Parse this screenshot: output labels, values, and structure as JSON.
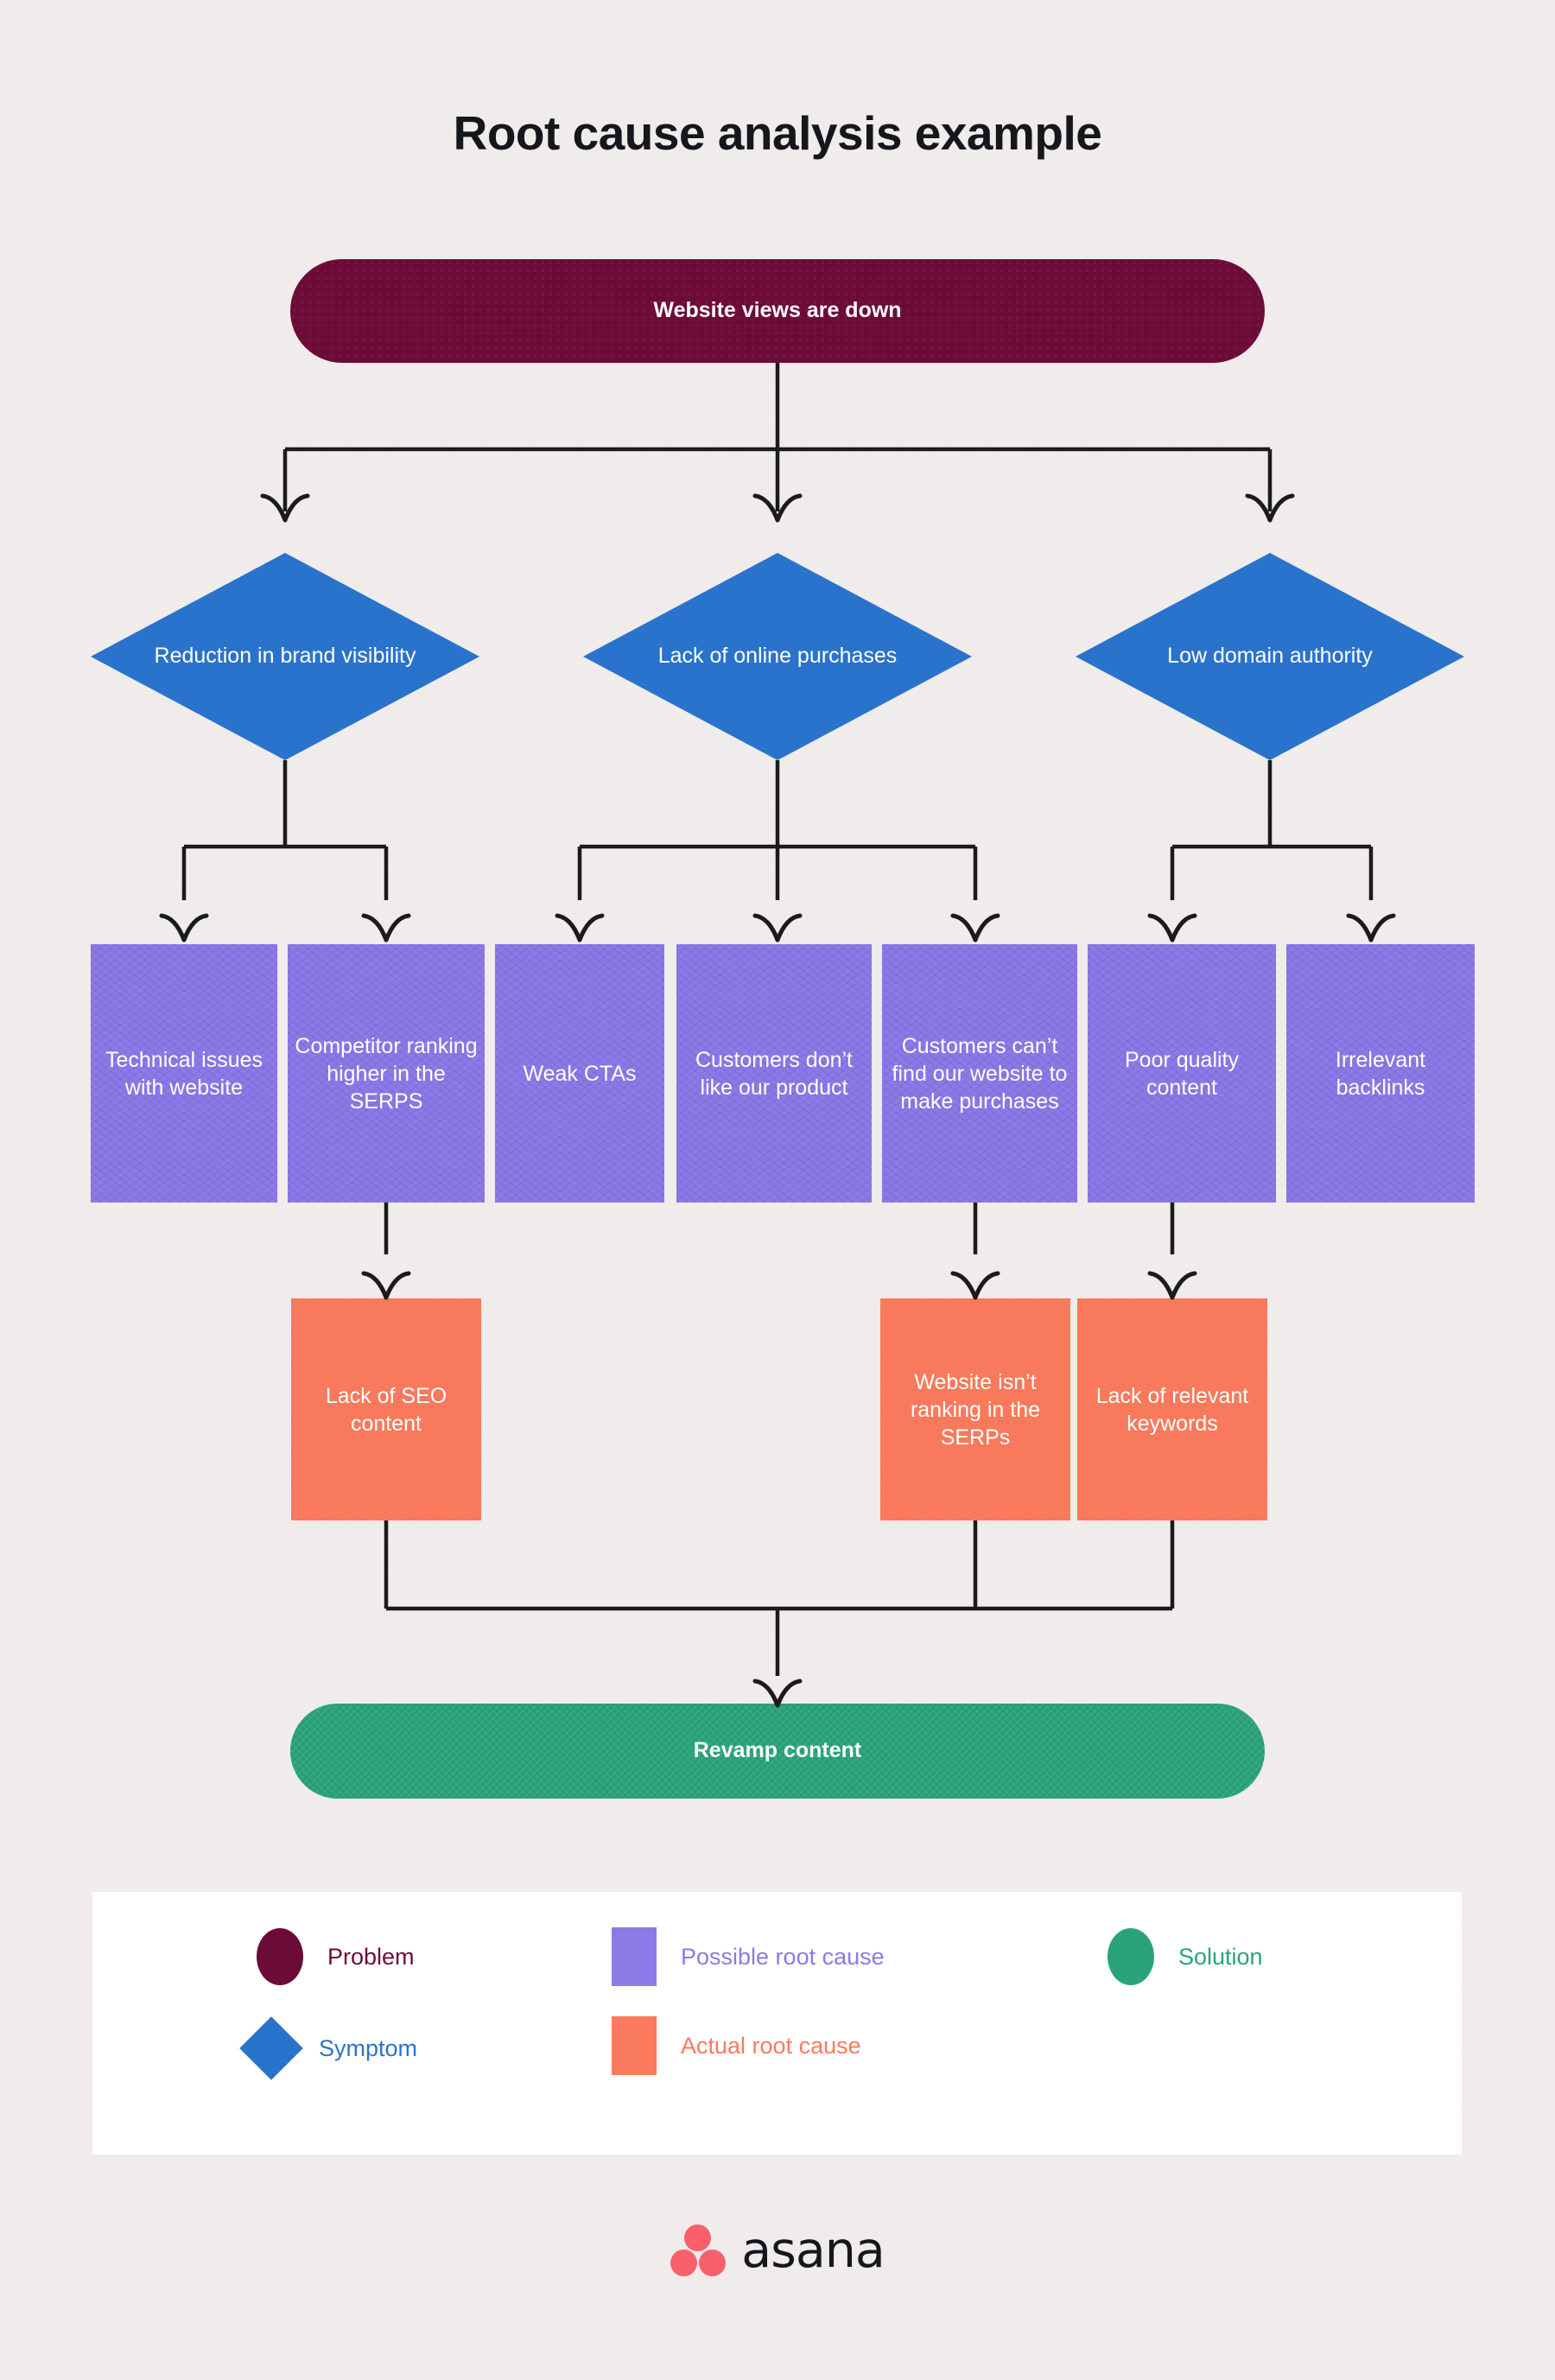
{
  "page": {
    "title": "Root cause analysis example"
  },
  "colors": {
    "background": "#efeceb",
    "problem": "#6d0b38",
    "symptom": "#2a73cc",
    "possible_root_cause": "#8c7ae6",
    "actual_root_cause": "#f97a5c",
    "solution": "#2aa37c",
    "connector": "#1b1b1b",
    "legend_panel": "#ffffff",
    "node_text": "#ffffff",
    "title_text": "#16161d",
    "logo_dot": "#f9606a"
  },
  "flow": {
    "problem": {
      "label": "Website views are down",
      "shape": "pill"
    },
    "symptoms": [
      {
        "label": "Reduction in brand visibility",
        "shape": "diamond"
      },
      {
        "label": "Lack of online purchases",
        "shape": "diamond"
      },
      {
        "label": "Low domain authority",
        "shape": "diamond"
      }
    ],
    "possible_root_causes": [
      {
        "label": "Technical issues with website",
        "shape": "rectangle"
      },
      {
        "label": "Competitor ranking higher in the SERPS",
        "shape": "rectangle"
      },
      {
        "label": "Weak CTAs",
        "shape": "rectangle"
      },
      {
        "label": "Customers don’t like our product",
        "shape": "rectangle"
      },
      {
        "label": "Customers can’t find our website to make purchases",
        "shape": "rectangle"
      },
      {
        "label": "Poor quality content",
        "shape": "rectangle"
      },
      {
        "label": "Irrelevant backlinks",
        "shape": "rectangle"
      }
    ],
    "actual_root_causes": [
      {
        "label": "Lack of SEO content",
        "shape": "rectangle"
      },
      {
        "label": "Website isn’t ranking in the SERPs",
        "shape": "rectangle"
      },
      {
        "label": "Lack of relevant keywords",
        "shape": "rectangle"
      }
    ],
    "solution": {
      "label": "Revamp content",
      "shape": "pill"
    }
  },
  "legend": {
    "items": [
      {
        "label": "Problem",
        "shape": "circle",
        "color": "#6d0b38"
      },
      {
        "label": "Symptom",
        "shape": "diamond",
        "color": "#2a73cc"
      },
      {
        "label": "Possible root cause",
        "shape": "square",
        "color": "#8c7ae6"
      },
      {
        "label": "Actual root cause",
        "shape": "square",
        "color": "#f97a5c"
      },
      {
        "label": "Solution",
        "shape": "circle",
        "color": "#2aa37c"
      }
    ]
  },
  "footer": {
    "brand": "asana"
  }
}
